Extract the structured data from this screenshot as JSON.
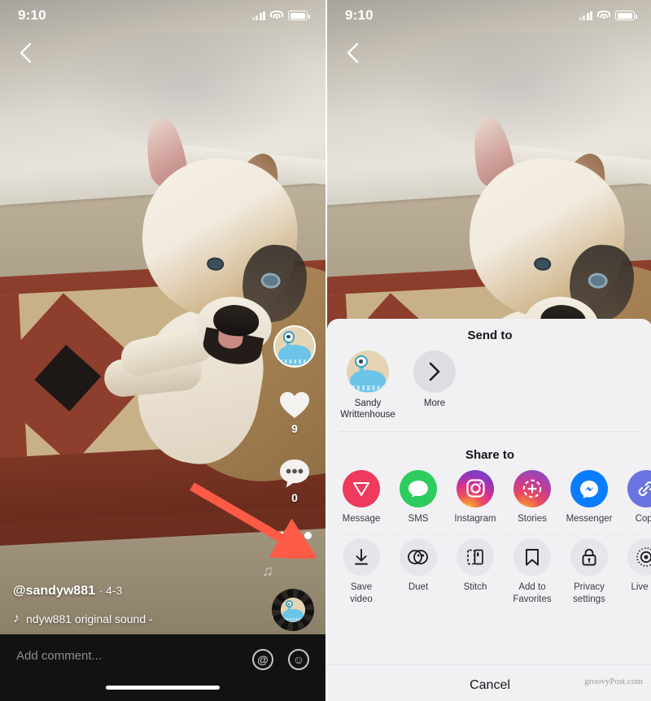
{
  "status_bar": {
    "time": "9:10",
    "signal_icon": "cellular-signal-icon",
    "wifi_icon": "wifi-icon",
    "battery_icon": "battery-icon"
  },
  "video": {
    "back_icon": "back-chevron-icon",
    "author": "@sandyw881",
    "date": "· 4-3",
    "sound_note_icon": "music-note-icon",
    "sound_text": "ndyw881   original sound -",
    "disc_icon": "vinyl-record-icon"
  },
  "rail": {
    "avatar_name": "profile-avatar",
    "like_icon": "heart-icon",
    "like_count": "9",
    "comment_icon": "comment-bubble-icon",
    "comment_count": "0",
    "more_icon": "three-dots-icon"
  },
  "comment_bar": {
    "placeholder": "Add comment...",
    "mention_icon": "at-mention-icon",
    "emoji_icon": "emoji-smiley-icon"
  },
  "sheet": {
    "send_to_title": "Send to",
    "send_to": [
      {
        "label": "Sandy\nWrittenhouse",
        "icon": "contact-avatar"
      },
      {
        "label": "More",
        "icon": "chevron-right-icon"
      }
    ],
    "share_to_title": "Share to",
    "share_to": [
      {
        "label": "Message",
        "icon": "tiktok-message-icon",
        "color": "#ef3a5d"
      },
      {
        "label": "SMS",
        "icon": "sms-bubble-icon",
        "color": "#2ecc5e"
      },
      {
        "label": "Instagram",
        "icon": "instagram-icon",
        "color": "#d9318c"
      },
      {
        "label": "Stories",
        "icon": "instagram-stories-icon",
        "color": "#c73c93"
      },
      {
        "label": "Messenger",
        "icon": "facebook-messenger-icon",
        "color": "#0a7cff"
      },
      {
        "label": "Copy",
        "icon": "copy-link-icon",
        "color": "#6a74e0"
      }
    ],
    "actions": [
      {
        "label": "Save video",
        "icon": "download-arrow-icon"
      },
      {
        "label": "Duet",
        "icon": "duet-circles-icon"
      },
      {
        "label": "Stitch",
        "icon": "stitch-icon"
      },
      {
        "label": "Add to\nFavorites",
        "icon": "bookmark-icon"
      },
      {
        "label": "Privacy\nsettings",
        "icon": "lock-icon"
      },
      {
        "label": "Live ph",
        "icon": "live-photo-icon"
      }
    ],
    "cancel_label": "Cancel"
  },
  "annotation": {
    "arrow_name": "red-arrow-pointer",
    "arrow_color": "#fc5b46"
  },
  "watermark": "groovyPost.com",
  "colors": {
    "sheet_bg": "#f1f1f4",
    "comment_bar_bg": "#121212",
    "accent_red": "#ef3a5d"
  }
}
